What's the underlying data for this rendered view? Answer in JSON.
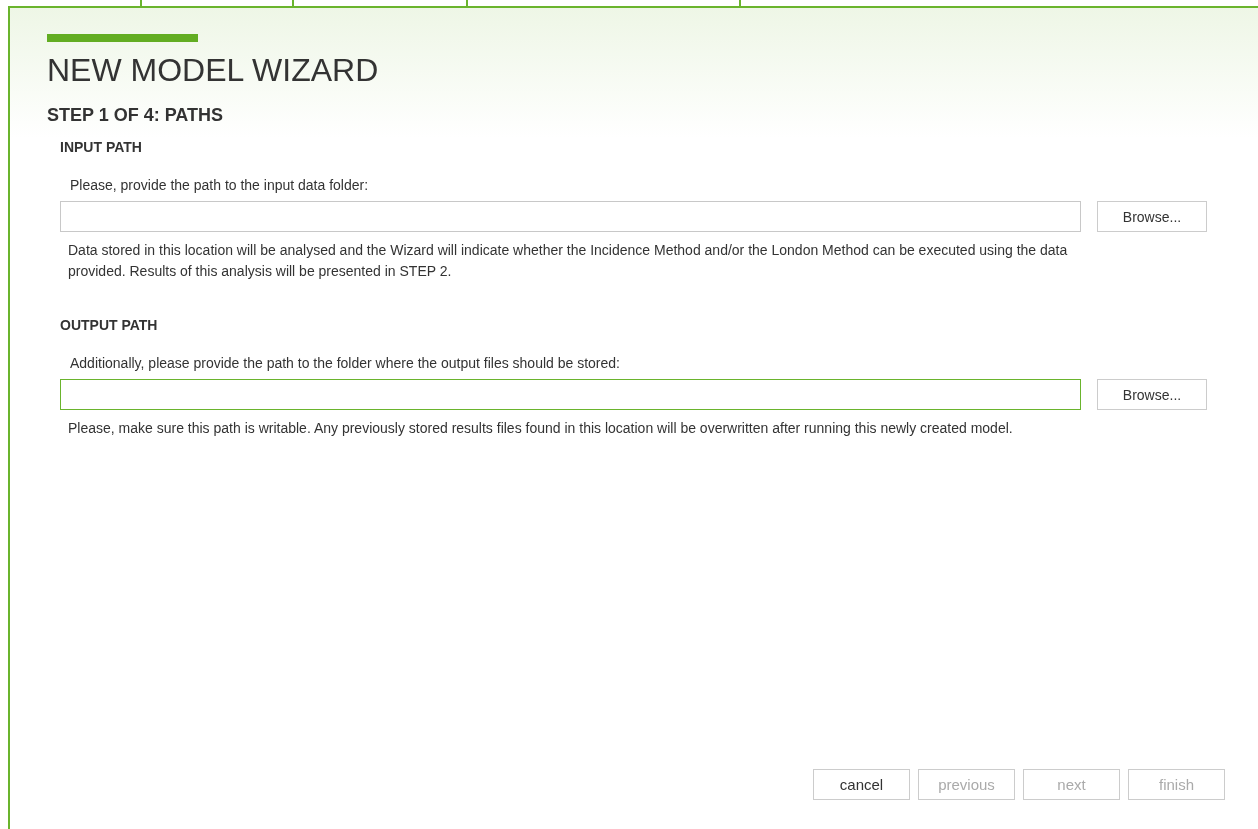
{
  "wizard": {
    "title": "NEW MODEL WIZARD",
    "step": "STEP 1 OF 4: PATHS"
  },
  "sections": [
    {
      "heading": "INPUT PATH",
      "prompt": "Please, provide the path to the input data folder:",
      "field": {
        "focused": false
      },
      "browse": "Browse...",
      "note": "Data stored in this location will be analysed and the Wizard will indicate whether the Incidence Method and/or the London Method can be executed using the data provided. Results of this analysis will be presented in STEP 2."
    },
    {
      "heading": "OUTPUT PATH",
      "prompt": "Additionally, please provide the path to the folder where the output files should be stored:",
      "field": {
        "focused": true
      },
      "browse": "Browse...",
      "note": "Please, make sure this path is writable. Any previously stored results files found in this location will be overwritten after running this newly created model."
    }
  ],
  "buttons": [
    {
      "label": "cancel",
      "disabled": false
    },
    {
      "label": "previous",
      "disabled": true
    },
    {
      "label": "next",
      "disabled": true
    },
    {
      "label": "finish",
      "disabled": true
    }
  ]
}
